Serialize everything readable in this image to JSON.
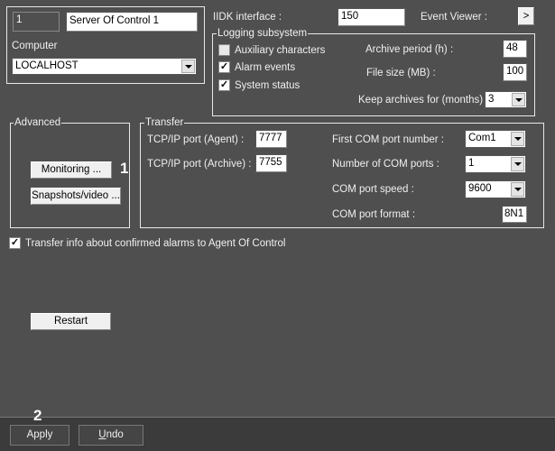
{
  "server": {
    "id": "1",
    "name": "Server Of Control 1",
    "computer_label": "Computer",
    "computer_value": "LOCALHOST"
  },
  "iidk": {
    "label": "IIDK interface :",
    "value": "150"
  },
  "event_viewer": {
    "label": "Event Viewer :",
    "button": ">"
  },
  "logging": {
    "title": "Logging subsystem",
    "checkboxes": [
      {
        "label": "Auxiliary characters",
        "checked": false
      },
      {
        "label": "Alarm events",
        "checked": true
      },
      {
        "label": "System status",
        "checked": true
      }
    ],
    "archive_period": {
      "label": "Archive period (h) :",
      "value": "48"
    },
    "file_size": {
      "label": "File size (MB) :",
      "value": "100"
    },
    "keep_archives": {
      "label": "Keep archives for (months) :",
      "value": "3"
    }
  },
  "advanced": {
    "title": "Advanced",
    "monitoring": "Monitoring ...",
    "snapshots": "Snapshots/video ..."
  },
  "transfer": {
    "title": "Transfer",
    "agent_port": {
      "label": "TCP/IP port (Agent) :",
      "value": "7777"
    },
    "archive_port": {
      "label": "TCP/IP port (Archive) :",
      "value": "7755"
    },
    "first_com": {
      "label": "First COM port number :",
      "value": "Com1"
    },
    "num_com": {
      "label": "Number of COM ports :",
      "value": "1"
    },
    "com_speed": {
      "label": "COM port speed :",
      "value": "9600"
    },
    "com_format": {
      "label": "COM port format :",
      "value": "8N1"
    }
  },
  "confirm_alarms": {
    "label": "Transfer info about confirmed alarms to Agent Of Control",
    "checked": true
  },
  "restart": "Restart",
  "callouts": [
    "1",
    "2"
  ],
  "footer": {
    "apply": "Apply",
    "undo_u": "U",
    "undo_rest": "ndo"
  }
}
